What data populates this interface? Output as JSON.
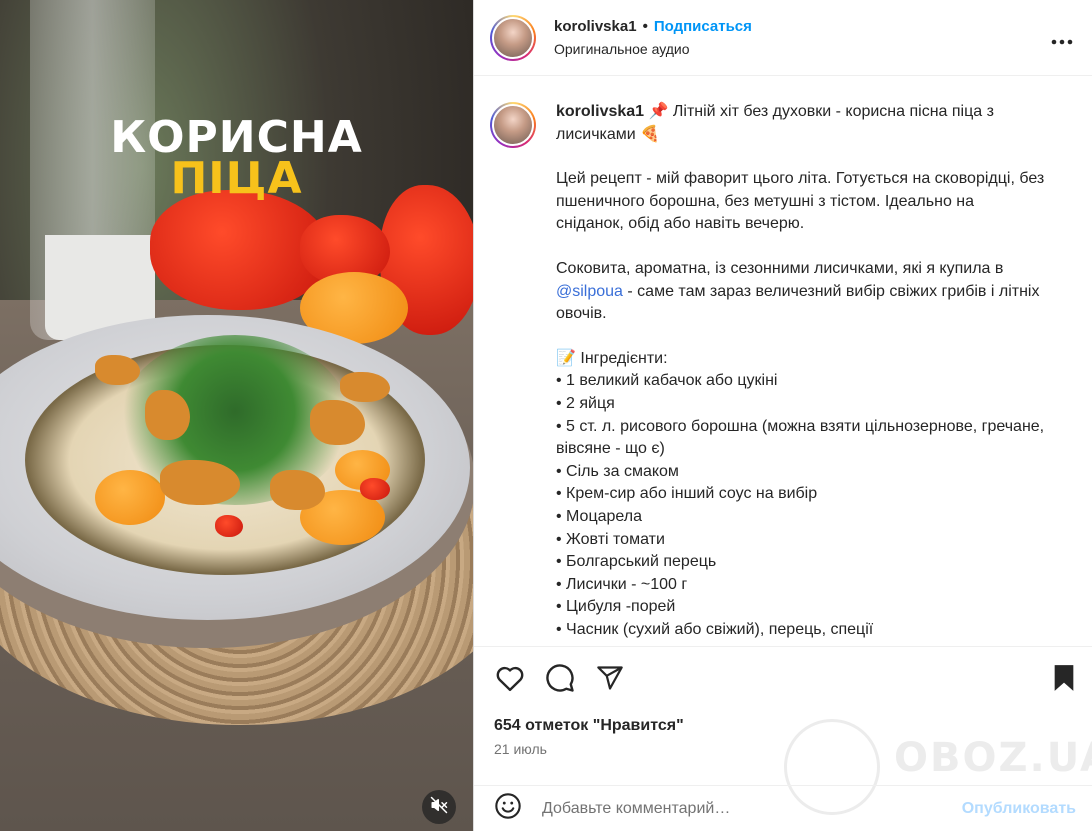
{
  "media": {
    "overlay_line1": "КОРИСНА",
    "overlay_line2": "ПІЦА",
    "mute_icon": "speaker-muted-icon"
  },
  "header": {
    "username": "korolivska1",
    "separator": "•",
    "follow_label": "Подписаться",
    "audio_label": "Оригинальное аудио",
    "more_icon": "more-options-icon"
  },
  "caption": {
    "username": "korolivska1",
    "title": "📌 Літній хіт без духовки - корисна пісна піца з лисичками 🍕",
    "para1": "Цей рецепт - мій фаворит цього літа. Готується на сковорідці, без пшеничного борошна, без метушні з тістом. Ідеально на сніданок, обід або навіть вечерю.",
    "para2_before": "Соковита, ароматна, із сезонними лисичками, які я купила в ",
    "mention": "@silpoua",
    "para2_after": " - саме там зараз величезний вибір свіжих грибів і літніх овочів.",
    "ingredients_title": "📝 Інгредієнти:",
    "ingredients": [
      "• 1 великий кабачок або цукіні",
      "• 2 яйця",
      "• 5 ст. л. рисового борошна (можна взяти цільнозернове, гречане, вівсяне - що є)",
      "• Сіль за смаком",
      "• Крем-сир або інший соус на вибір",
      "• Моцарела",
      "• Жовті томати",
      "• Болгарський перець",
      "• Лисички - ~100 г",
      "• Цибуля -порей",
      "• Часник (сухий або свіжий), перець, спеції"
    ]
  },
  "actions": {
    "icons": [
      "heart-icon",
      "comment-icon",
      "share-icon",
      "bookmark-icon"
    ],
    "likes": "654 отметок \"Нравится\"",
    "date": "21 июль"
  },
  "watermark": "OBOZ.UA",
  "comment": {
    "emoji_icon": "emoji-icon",
    "placeholder": "Добавьте комментарий…",
    "publish_label": "Опубликовать"
  }
}
